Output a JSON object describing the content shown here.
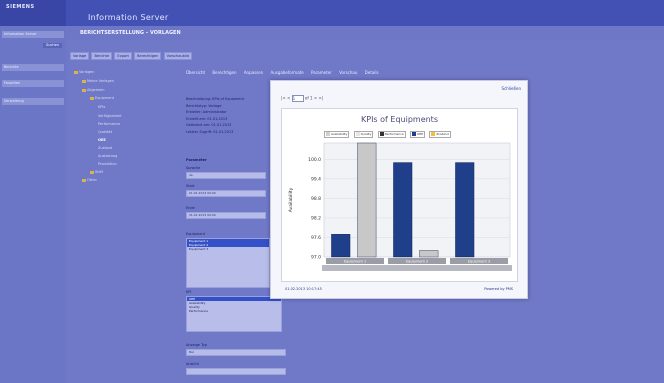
{
  "app": {
    "brand": "SIEMENS",
    "title": "Information Server"
  },
  "page": {
    "subtitle": "BERICHTSERSTELLUNG – VORLAGEN"
  },
  "sidebar": {
    "items": [
      {
        "label": "Information Server"
      },
      {
        "label": "Berichte"
      },
      {
        "label": "Favoriten"
      },
      {
        "label": "Verwaltung"
      }
    ],
    "button_label": "Suchen"
  },
  "tabs": [
    {
      "label": "Vorlage"
    },
    {
      "label": "Berichte"
    },
    {
      "label": "Export"
    },
    {
      "label": "Berechtigen"
    },
    {
      "label": "Vorschaubild"
    }
  ],
  "tree": {
    "items": [
      {
        "label": "Vorlagen",
        "depth": 0
      },
      {
        "label": "Meine Vorlagen",
        "depth": 1
      },
      {
        "label": "Allgemein",
        "depth": 1
      },
      {
        "label": "Equipment",
        "depth": 2
      },
      {
        "label": "KPIs",
        "depth": 3
      },
      {
        "label": "Verfügbarkeit",
        "depth": 3
      },
      {
        "label": "Performance",
        "depth": 3
      },
      {
        "label": "Qualität",
        "depth": 3
      },
      {
        "label": "OEE",
        "depth": 3
      },
      {
        "label": "Zustand",
        "depth": 3
      },
      {
        "label": "Auslastung",
        "depth": 3
      },
      {
        "label": "Produktion",
        "depth": 3
      },
      {
        "label": "Shift",
        "depth": 2
      },
      {
        "label": "Other",
        "depth": 1
      }
    ]
  },
  "content_tabs": [
    "Übersicht",
    "Berechtigen",
    "Anpassen",
    "Ausgabeformate",
    "Parameter",
    "Vorschau",
    "Details"
  ],
  "info_lines": [
    "Beschreibung: KPIs of Equipment",
    "Berichtstyp: Vorlage",
    "Ersteller: Administrator",
    "Erstellt am: 01.01.2013",
    "Geändert am: 01.01.2013",
    "Letzter Zugriff: 01.01.2013"
  ],
  "form": {
    "section_label": "Parameter",
    "fields": [
      {
        "label": "Sprache",
        "value": "de"
      },
      {
        "label": "Start",
        "value": "01.01.2013 00:00"
      },
      {
        "label": "Ende",
        "value": "31.01.2013 00:00"
      }
    ],
    "equipment_label": "Equipment",
    "equipment_options": [
      "Equipment 1",
      "Equipment 2",
      "Equipment 3"
    ],
    "kpi_label": "KPI",
    "kpi_options": [
      "OEE",
      "Availability",
      "Quality",
      "Performance"
    ],
    "type_label": "Anzeige Typ",
    "type_value": "Bar",
    "view_label": "Ansicht"
  },
  "modal": {
    "close_label": "Schließen",
    "pager": {
      "prefix": "|<  <",
      "page_value": "1",
      "suffix": "of 1  >  >|"
    },
    "footer_left": "01.02.2013 10:17:45",
    "footer_right": "Powered by PMS"
  },
  "chart_data": {
    "type": "bar",
    "title": "KPIs of Equipments",
    "ylabel": "Availability",
    "ylim": [
      97.0,
      100.5
    ],
    "yticks": [
      97.0,
      97.6,
      98.2,
      98.8,
      99.4,
      100.0
    ],
    "categories": [
      "Equipment 1",
      "Equipment 2",
      "Equipment 3"
    ],
    "series": [
      {
        "name": "Availability",
        "color": "#1f3f8a",
        "values": [
          97.7,
          99.9,
          99.9
        ]
      },
      {
        "name": "Quality",
        "color": "#c8c8c8",
        "values": [
          100.5,
          97.2,
          null
        ]
      }
    ],
    "legend": [
      "Availability",
      "Quality",
      "Performance",
      "OEE",
      "Zustand"
    ],
    "legend_colors": [
      "#d0d0d0",
      "#e6e6e6",
      "#333333",
      "#1f3f8a",
      "#f0c040"
    ]
  }
}
